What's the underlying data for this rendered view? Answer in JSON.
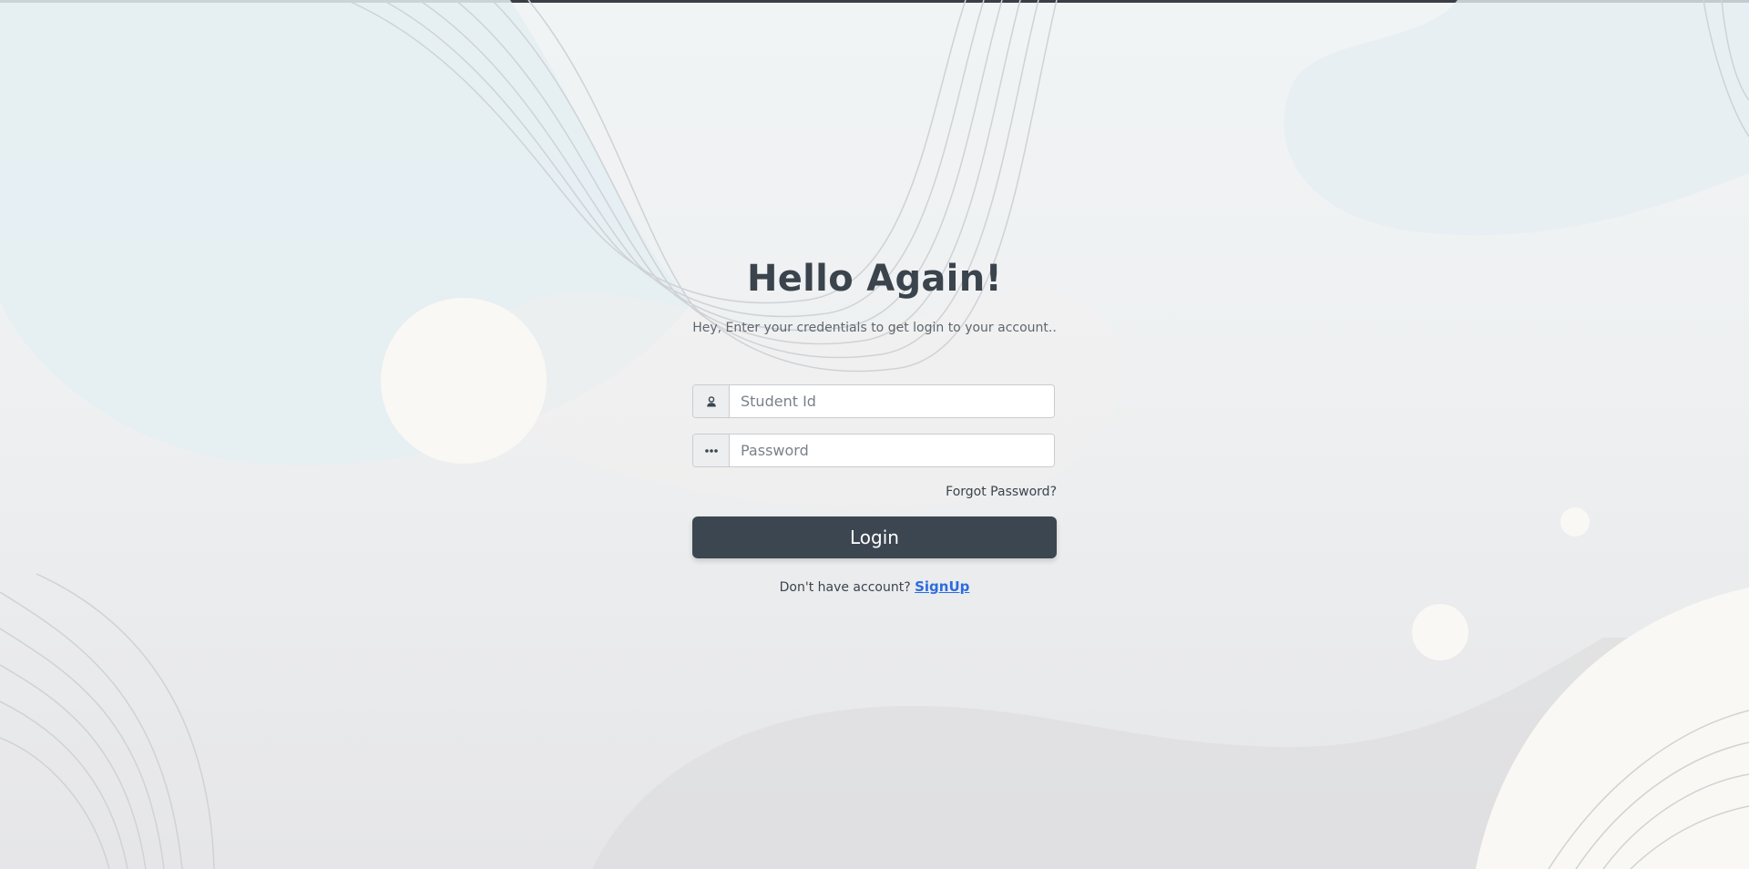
{
  "login": {
    "title": "Hello Again!",
    "subtitle": "Hey, Enter your credentials to get login to your account..",
    "student_id": {
      "placeholder": "Student Id",
      "value": "",
      "icon": "user-icon"
    },
    "password": {
      "placeholder": "Password",
      "value": "",
      "icon": "password-dots-icon"
    },
    "forgot_password_label": "Forgot Password?",
    "login_button_label": "Login",
    "signup_prompt": "Don't have account?",
    "signup_link_label": "SignUp"
  },
  "colors": {
    "primary_button": "#3b4650",
    "link": "#2b6de0",
    "heading": "#3b444d"
  }
}
